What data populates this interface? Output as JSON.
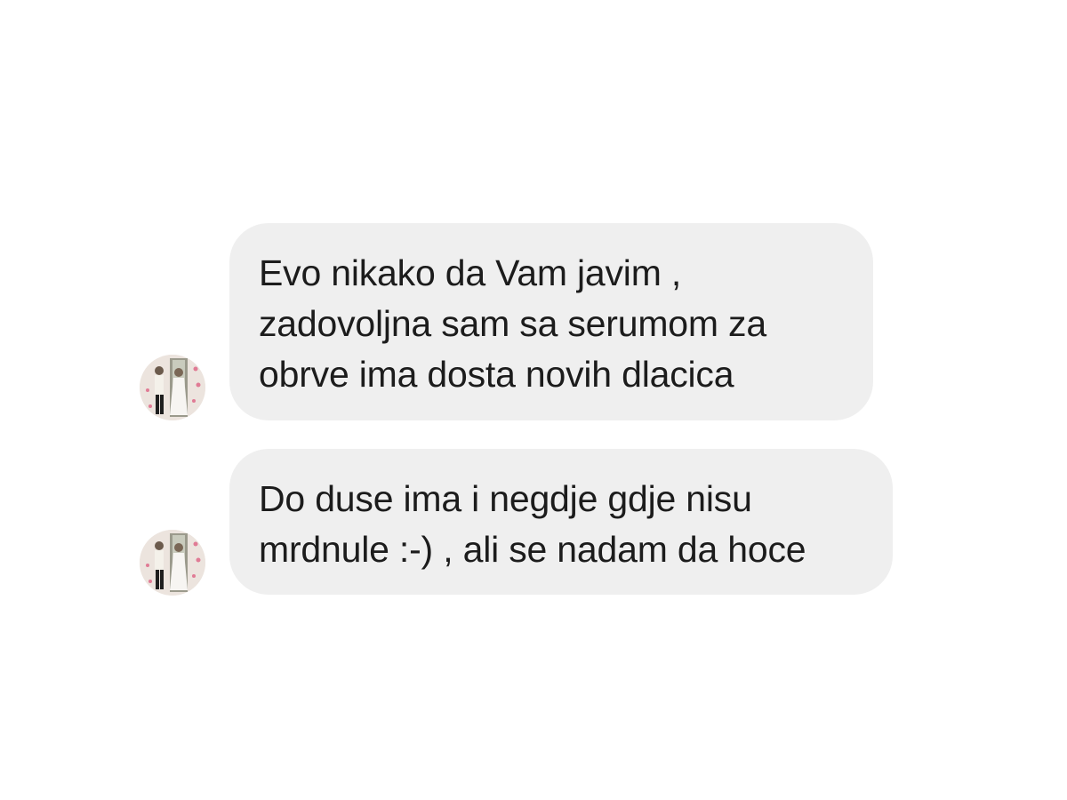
{
  "messages": [
    {
      "lines": [
        "Evo nikako da Vam javim ,",
        "zadovoljna sam sa serumom za",
        "obrve ima dosta novih dlacica"
      ],
      "avatar_icon": "user-avatar-photo"
    },
    {
      "lines": [
        "Do duse ima i negdje gdje nisu",
        "mrdnule :-) , ali se nadam da hoce"
      ],
      "avatar_icon": "user-avatar-photo"
    }
  ],
  "colors": {
    "background": "#ffffff",
    "bubble": "#efefef",
    "text": "#1c1c1c"
  }
}
